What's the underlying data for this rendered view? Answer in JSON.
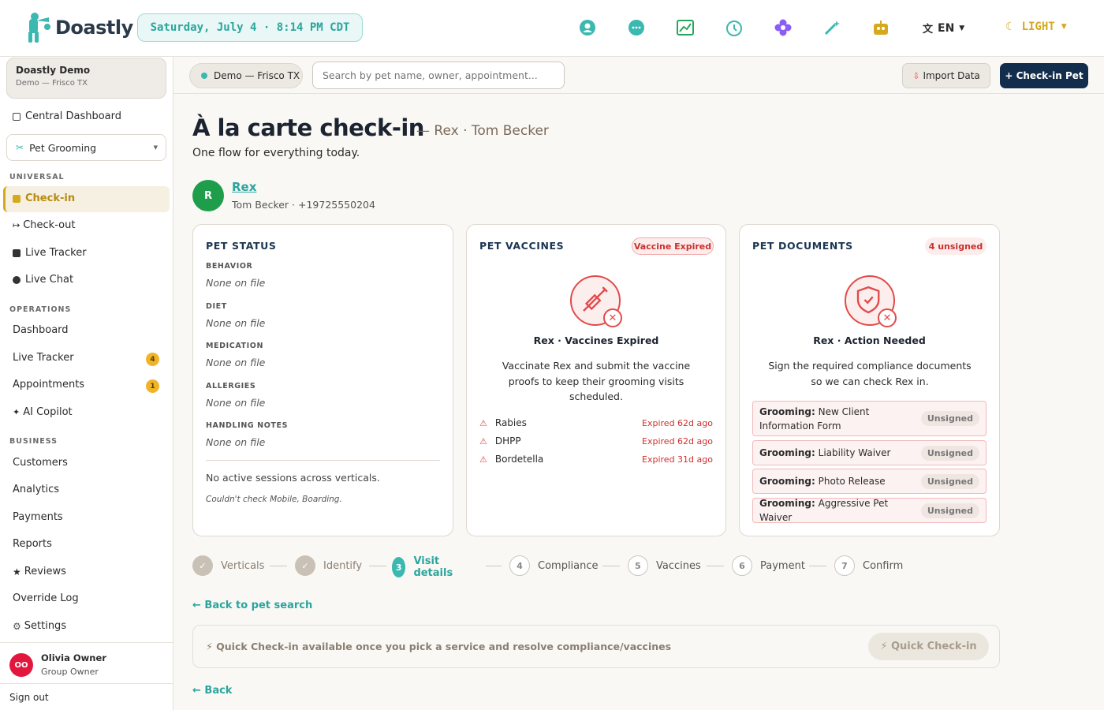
{
  "brand": {
    "name": "Doastly"
  },
  "datetime": "Saturday, July 4 · 8:14 PM CDT",
  "topbar": {
    "icons": [
      "user-circle-icon",
      "chat-bubble-icon",
      "chart-icon",
      "clock-icon",
      "flower-icon",
      "magic-wand-icon",
      "robot-icon"
    ],
    "language": "EN",
    "theme": "LIGHT"
  },
  "sidebar": {
    "org_name": "Doastly Demo",
    "org_location": "Demo — Frisco TX",
    "central_dashboard": "Central Dashboard",
    "vertical": "Pet Grooming",
    "sections": {
      "universal": "UNIVERSAL",
      "operations": "OPERATIONS",
      "business": "BUSINESS"
    },
    "universal": [
      "Check-in",
      "Check-out",
      "Live Tracker",
      "Live Chat"
    ],
    "operations": [
      "Dashboard",
      "Live Tracker",
      "Appointments",
      "AI Copilot"
    ],
    "operations_badges": {
      "live_tracker": "4",
      "appointments": "1"
    },
    "business": [
      "Customers",
      "Analytics",
      "Payments",
      "Reports",
      "Reviews",
      "Override Log",
      "Settings"
    ],
    "user": {
      "initials": "OO",
      "name": "Olivia Owner",
      "role": "Group Owner"
    },
    "sign_out": "Sign out"
  },
  "subbar": {
    "location": "Demo — Frisco TX",
    "search_placeholder": "Search by pet name, owner, appointment...",
    "import": "Import Data",
    "checkin": "+ Check-in Pet"
  },
  "page": {
    "title": "À la carte check-in",
    "title_sub": "— Rex · Tom Becker",
    "subtitle": "One flow for everything today."
  },
  "pet": {
    "initial": "R",
    "name": "Rex",
    "owner_line": "Tom Becker · +19725550204"
  },
  "status_card": {
    "heading": "PET STATUS",
    "fields": [
      {
        "label": "BEHAVIOR",
        "value": "None on file"
      },
      {
        "label": "DIET",
        "value": "None on file"
      },
      {
        "label": "MEDICATION",
        "value": "None on file"
      },
      {
        "label": "ALLERGIES",
        "value": "None on file"
      },
      {
        "label": "HANDLING NOTES",
        "value": "None on file"
      }
    ],
    "sessions": "No active sessions across verticals.",
    "note": "Couldn't check Mobile, Boarding."
  },
  "vaccines_card": {
    "heading": "PET VACCINES",
    "badge": "Vaccine Expired",
    "title": "Rex · Vaccines Expired",
    "desc": "Vaccinate Rex and submit the vaccine proofs to keep their grooming visits scheduled.",
    "items": [
      {
        "name": "Rabies",
        "status": "Expired 62d ago"
      },
      {
        "name": "DHPP",
        "status": "Expired 62d ago"
      },
      {
        "name": "Bordetella",
        "status": "Expired 31d ago"
      }
    ]
  },
  "documents_card": {
    "heading": "PET DOCUMENTS",
    "badge": "4 unsigned",
    "title": "Rex · Action Needed",
    "desc": "Sign the required compliance documents so we can check Rex in.",
    "docs": [
      {
        "prefix": "Grooming:",
        "name": "New Client Information Form",
        "status": "Unsigned"
      },
      {
        "prefix": "Grooming:",
        "name": "Liability Waiver",
        "status": "Unsigned"
      },
      {
        "prefix": "Grooming:",
        "name": "Photo Release",
        "status": "Unsigned"
      },
      {
        "prefix": "Grooming:",
        "name": "Aggressive Pet Waiver",
        "status": "Unsigned"
      }
    ]
  },
  "steps": [
    {
      "num": "✓",
      "label": "Verticals",
      "state": "done"
    },
    {
      "num": "✓",
      "label": "Identify",
      "state": "done"
    },
    {
      "num": "3",
      "label": "Visit details",
      "state": "current"
    },
    {
      "num": "4",
      "label": "Compliance",
      "state": "todo"
    },
    {
      "num": "5",
      "label": "Vaccines",
      "state": "todo"
    },
    {
      "num": "6",
      "label": "Payment",
      "state": "todo"
    },
    {
      "num": "7",
      "label": "Confirm",
      "state": "todo"
    }
  ],
  "back_to_search": "← Back to pet search",
  "quick": {
    "text": "⚡ Quick Check-in available once you pick a service and resolve compliance/vaccines",
    "button": "⚡ Quick Check-in"
  },
  "back": "← Back",
  "colors": {
    "accent": "#2aa59d",
    "navy": "#132e4d",
    "danger": "#e24a4a",
    "warning": "#d6a81c"
  }
}
